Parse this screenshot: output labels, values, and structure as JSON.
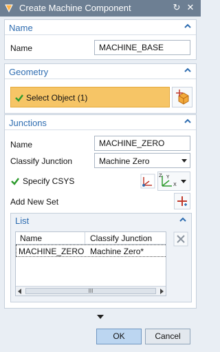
{
  "window": {
    "title": "Create Machine Component"
  },
  "name_section": {
    "title": "Name",
    "name_label": "Name",
    "name_value": "MACHINE_BASE"
  },
  "geometry_section": {
    "title": "Geometry",
    "select_object_label": "Select Object (1)"
  },
  "junctions_section": {
    "title": "Junctions",
    "name_label": "Name",
    "name_value": "MACHINE_ZERO",
    "classify_label": "Classify Junction",
    "classify_value": "Machine Zero",
    "specify_csys_label": "Specify CSYS",
    "add_new_set_label": "Add New Set"
  },
  "list_section": {
    "title": "List",
    "columns": [
      "Name",
      "Classify Junction"
    ],
    "rows": [
      {
        "name": "MACHINE_ZERO",
        "classify": "Machine Zero*"
      }
    ],
    "scroll_grip": "III"
  },
  "buttons": {
    "ok": "OK",
    "cancel": "Cancel"
  },
  "colors": {
    "accent": "#2d6cb0",
    "select_highlight": "#f6c566",
    "titlebar": "#6d7f93"
  }
}
